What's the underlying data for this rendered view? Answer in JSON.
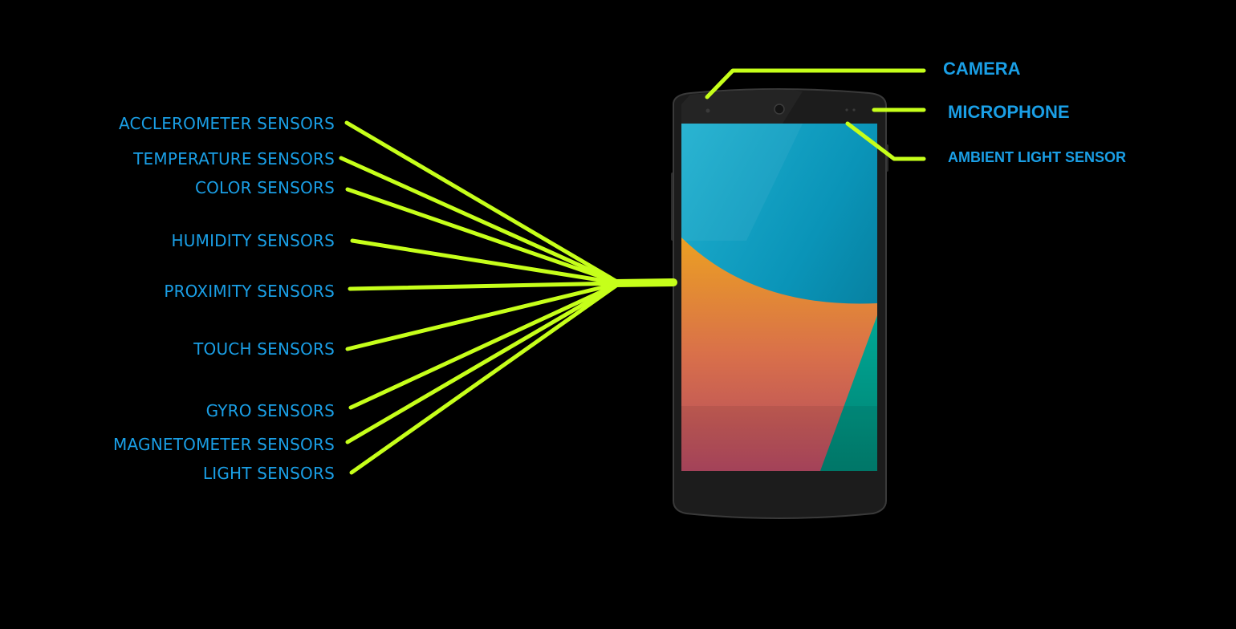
{
  "diagram": {
    "colors": {
      "background": "#000000",
      "label": "#1a9fe6",
      "connector": "#c6ff1a",
      "phone_body": "#1c1c1c"
    },
    "left_sensors": [
      {
        "label": "ACCLEROMETER SENSORS"
      },
      {
        "label": "TEMPERATURE SENSORS"
      },
      {
        "label": "COLOR SENSORS"
      },
      {
        "label": "HUMIDITY SENSORS"
      },
      {
        "label": "PROXIMITY SENSORS"
      },
      {
        "label": "TOUCH SENSORS"
      },
      {
        "label": "GYRO SENSORS"
      },
      {
        "label": "MAGNETOMETER SENSORS"
      },
      {
        "label": "LIGHT SENSORS"
      }
    ],
    "right_components": [
      {
        "label": "CAMERA"
      },
      {
        "label": "MICROPHONE"
      },
      {
        "label": "AMBIENT LIGHT SENSOR"
      }
    ]
  }
}
